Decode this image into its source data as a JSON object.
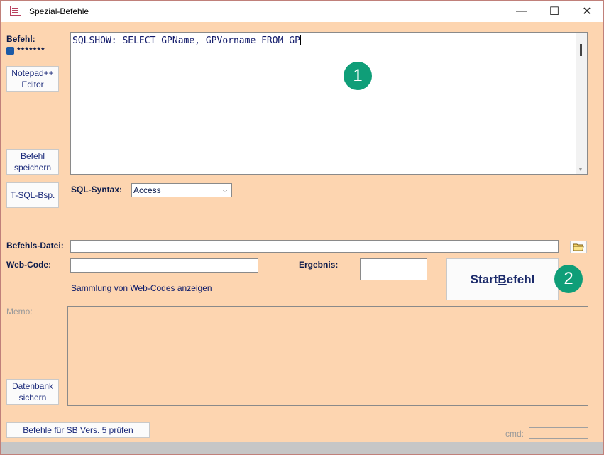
{
  "window": {
    "title": "Spezial-Befehle",
    "minimize_glyph": "—",
    "maximize_glyph": "☐",
    "close_glyph": "✕"
  },
  "left": {
    "befehl_label": "Befehl:",
    "collapse_glyph": "−",
    "masked_value": "*******",
    "notepad_button": "Notepad++\nEditor",
    "save_button": "Befehl\nspeichern",
    "tsql_button": "T-SQL-Bsp.",
    "backup_button": "Datenbank\nsichern",
    "check_button": "Befehle für SB Vers. 5 prüfen"
  },
  "editor": {
    "sql_text": "SQLSHOW: SELECT GPName, GPVorname FROM GP",
    "scroll_arrow": "▼"
  },
  "syntax": {
    "label": "SQL-Syntax:",
    "selected": "Access",
    "arrow": "⌵"
  },
  "form": {
    "file_label": "Befehls-Datei:",
    "file_value": "",
    "webcode_label": "Web-Code:",
    "webcode_value": "",
    "result_label": "Ergebnis:",
    "result_value": "",
    "webcodes_link": "Sammlung von Web-Codes anzeigen",
    "start_button_prefix": "Start ",
    "start_button_hotkey": "B",
    "start_button_rest": "efehl",
    "memo_label": "Memo:",
    "memo_value": "",
    "cmd_label": "cmd:",
    "cmd_value": ""
  },
  "markers": {
    "one": "1",
    "two": "2"
  },
  "colors": {
    "background": "#fdd5b0",
    "marker": "#0f9e78",
    "label_text": "#0b1a4a"
  }
}
